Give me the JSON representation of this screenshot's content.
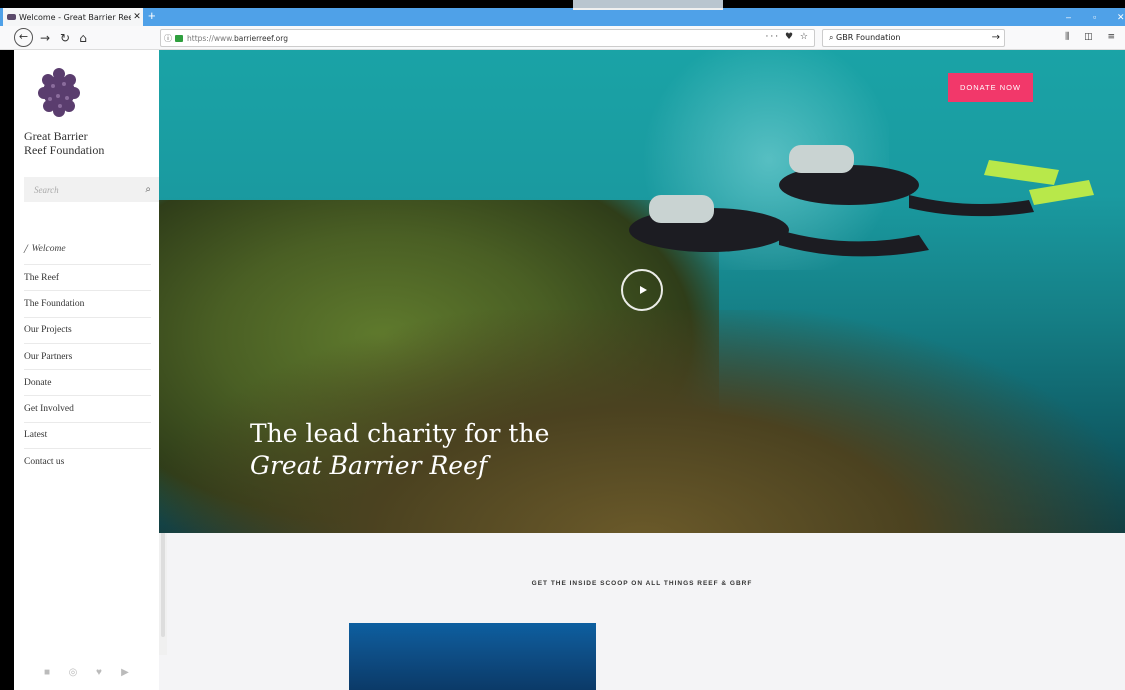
{
  "browser": {
    "tab_title": "Welcome - Great Barrier Reef F",
    "tab_close": "✕",
    "new_tab": "+",
    "url_scheme": "https://www.",
    "url_domain": "barrierreef.org",
    "url_actions": "··· ♥ ☆",
    "search_value": "GBR Foundation",
    "search_go": "→",
    "tools": "⫼ ◫ ≡",
    "win_min": "–",
    "win_max": "▫",
    "win_close": "✕"
  },
  "sidebar": {
    "org_name_line1": "Great Barrier",
    "org_name_line2": "Reef Foundation",
    "search_placeholder": "Search",
    "menu": [
      {
        "label": "Welcome"
      },
      {
        "label": "The Reef"
      },
      {
        "label": "The Foundation"
      },
      {
        "label": "Our Projects"
      },
      {
        "label": "Our Partners"
      },
      {
        "label": "Donate"
      },
      {
        "label": "Get Involved"
      },
      {
        "label": "Latest"
      },
      {
        "label": "Contact us"
      }
    ],
    "social_icons": [
      "facebook-icon",
      "instagram-icon",
      "twitter-icon",
      "youtube-icon"
    ]
  },
  "hero": {
    "donate_label": "DONATE NOW",
    "tagline_line1": "The lead charity for the",
    "tagline_line2": "Great Barrier Reef"
  },
  "content": {
    "scoop_heading": "GET THE INSIDE SCOOP ON ALL THINGS REEF & GBRF"
  },
  "colors": {
    "accent": "#f2386a",
    "tabbar": "#4fa1e8"
  }
}
